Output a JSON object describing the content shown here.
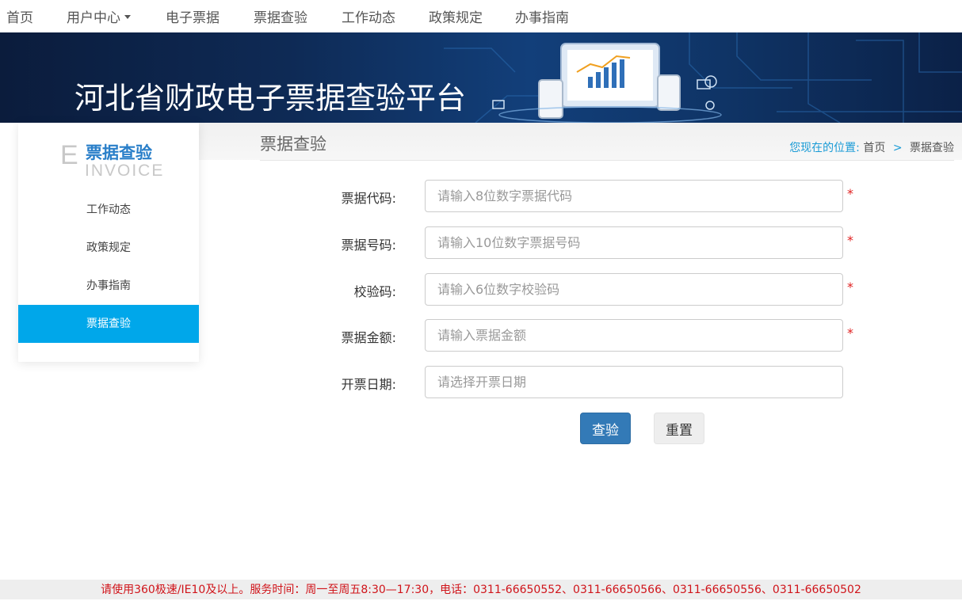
{
  "nav": {
    "items": [
      "首页",
      "用户中心",
      "电子票据",
      "票据查验",
      "工作动态",
      "政策规定",
      "办事指南"
    ]
  },
  "banner": {
    "title": "河北省财政电子票据查验平台"
  },
  "sidebar": {
    "logo_letter": "E",
    "logo_cn": "票据查验",
    "logo_en": "INVOICE",
    "items": [
      {
        "label": "工作动态",
        "active": false
      },
      {
        "label": "政策规定",
        "active": false
      },
      {
        "label": "办事指南",
        "active": false
      },
      {
        "label": "票据查验",
        "active": true
      }
    ]
  },
  "main": {
    "title": "票据查验",
    "breadcrumb": {
      "label": "您现在的位置:",
      "home": "首页",
      "sep": ">",
      "current": "票据查验"
    }
  },
  "form": {
    "fields": [
      {
        "label": "票据代码:",
        "placeholder": "请输入8位数字票据代码",
        "value": "",
        "required": true
      },
      {
        "label": "票据号码:",
        "placeholder": "请输入10位数字票据号码",
        "value": "",
        "required": true
      },
      {
        "label": "校验码:",
        "placeholder": "请输入6位数字校验码",
        "value": "",
        "required": true
      },
      {
        "label": "票据金额:",
        "placeholder": "请输入票据金额",
        "value": "",
        "required": true
      },
      {
        "label": "开票日期:",
        "placeholder": "请选择开票日期",
        "value": "",
        "required": false
      }
    ],
    "required_mark": "*",
    "submit_label": "查验",
    "reset_label": "重置"
  },
  "footer": {
    "text": "请使用360极速/IE10及以上。服务时间：周一至周五8:30—17:30，电话：0311-66650552、0311-66650566、0311-66650556、0311-66650502"
  },
  "colors": {
    "accent": "#00a7ea",
    "primary_button": "#337ab7",
    "required": "#e02020",
    "footer_text": "#d0141a"
  }
}
